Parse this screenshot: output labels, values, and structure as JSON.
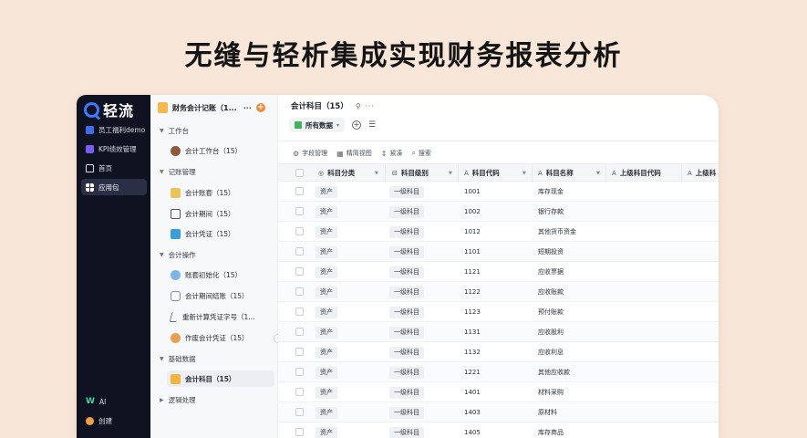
{
  "headline": "无缝与轻析集成实现财务报表分析",
  "app": {
    "logo_text": "轻流",
    "rail_items": [
      {
        "label": "员工福利demo",
        "icon": "welfare-app-icon"
      },
      {
        "label": "KPI绩效管理",
        "icon": "kpi-app-icon"
      },
      {
        "label": "首页",
        "icon": "home-icon"
      },
      {
        "label": "应用包",
        "icon": "apps-grid-icon"
      }
    ],
    "rail_bottom": [
      {
        "label": "AI",
        "glyph": "W"
      },
      {
        "label": "创建"
      }
    ]
  },
  "panel": {
    "title": "财务会计记账（1...",
    "more": "···",
    "add": "+",
    "groups": [
      {
        "label": "工作台",
        "items": [
          {
            "label": "会计工作台（15）",
            "icon": "workbench-icon"
          }
        ]
      },
      {
        "label": "记账管理",
        "items": [
          {
            "label": "会计账套（15）",
            "icon": "books-icon"
          },
          {
            "label": "会计期间（15）",
            "icon": "period-icon"
          },
          {
            "label": "会计凭证（15）",
            "icon": "voucher-icon"
          }
        ]
      },
      {
        "label": "会计操作",
        "items": [
          {
            "label": "账套初始化（15）",
            "icon": "init-icon"
          },
          {
            "label": "会计期间结账（15）",
            "icon": "period-close-icon"
          },
          {
            "label": "重新计算凭证字号（1...",
            "icon": "recalc-icon"
          },
          {
            "label": "作废会计凭证（15）",
            "icon": "void-voucher-icon"
          }
        ]
      },
      {
        "label": "基础数据",
        "items": [
          {
            "label": "会计科目（15）",
            "icon": "folder-icon"
          }
        ]
      },
      {
        "label": "逻辑处理",
        "items": []
      }
    ]
  },
  "main": {
    "title": "会计科目（15）",
    "title_tools": "⚲ ···",
    "view_tab": "所有数据",
    "toolbar": [
      {
        "label": "字段管理",
        "icon": "field-manage-icon",
        "glyph": "⚙"
      },
      {
        "label": "精简视图",
        "icon": "compact-view-icon",
        "glyph": "▦"
      },
      {
        "label": "紧凑",
        "icon": "density-icon",
        "glyph": "↕"
      },
      {
        "label": "搜索",
        "icon": "search-icon",
        "glyph": "⌕"
      }
    ],
    "columns": [
      {
        "label": "科目分类",
        "glyph": "◎"
      },
      {
        "label": "科目级别",
        "glyph": "⊟"
      },
      {
        "label": "科目代码",
        "glyph": "A"
      },
      {
        "label": "科目名称",
        "glyph": "A"
      },
      {
        "label": "上级科目代码",
        "glyph": "A"
      },
      {
        "label": "上级科",
        "glyph": "A"
      }
    ],
    "rows": [
      {
        "category": "资产",
        "level": "一级科目",
        "code": "1001",
        "name": "库存现金"
      },
      {
        "category": "资产",
        "level": "一级科目",
        "code": "1002",
        "name": "银行存款"
      },
      {
        "category": "资产",
        "level": "一级科目",
        "code": "1012",
        "name": "其他货币资金"
      },
      {
        "category": "资产",
        "level": "一级科目",
        "code": "1101",
        "name": "短期投资"
      },
      {
        "category": "资产",
        "level": "一级科目",
        "code": "1121",
        "name": "应收票据"
      },
      {
        "category": "资产",
        "level": "一级科目",
        "code": "1122",
        "name": "应收账款"
      },
      {
        "category": "资产",
        "level": "一级科目",
        "code": "1123",
        "name": "预付账款"
      },
      {
        "category": "资产",
        "level": "一级科目",
        "code": "1131",
        "name": "应收股利"
      },
      {
        "category": "资产",
        "level": "一级科目",
        "code": "1132",
        "name": "应收利息"
      },
      {
        "category": "资产",
        "level": "一级科目",
        "code": "1221",
        "name": "其他应收款"
      },
      {
        "category": "资产",
        "level": "一级科目",
        "code": "1401",
        "name": "材料采购"
      },
      {
        "category": "资产",
        "level": "一级科目",
        "code": "1403",
        "name": "原材料"
      },
      {
        "category": "资产",
        "level": "一级科目",
        "code": "1405",
        "name": "库存商品"
      }
    ]
  }
}
